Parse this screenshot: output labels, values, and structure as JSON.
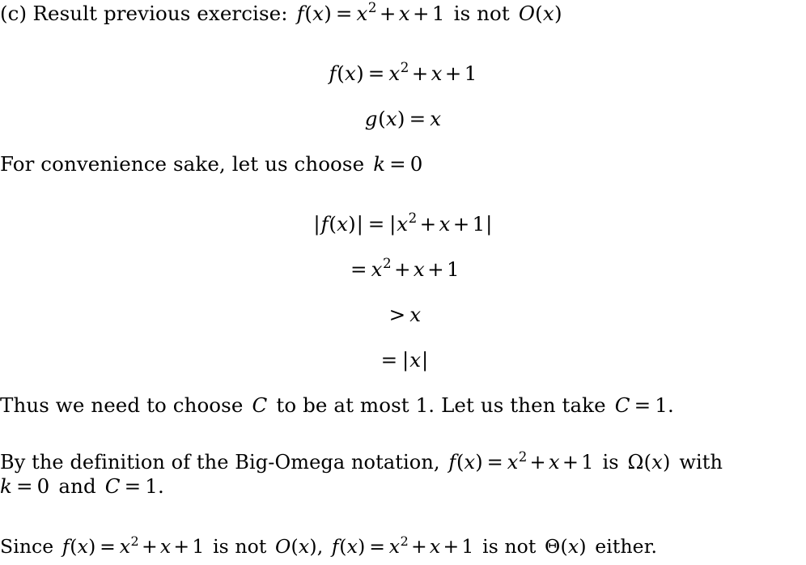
{
  "document": {
    "title": "(c) Result previous exercise",
    "background_color": "#ffffff",
    "text_color": "#000000"
  },
  "lines": {
    "heading": {
      "label": "(c)",
      "text": "Result previous exercise:",
      "math": "f(x) = x^2 + x + 1",
      "tail": "is not",
      "math2": "O(x)",
      "full": "(c) Result previous exercise: f(x) = x^2 + x + 1 is not O(x)"
    },
    "display1": {
      "full": "f(x) = x^2 + x + 1"
    },
    "display2": {
      "full": "g(x) = x"
    },
    "convenience": {
      "text": "For convenience sake, let us choose",
      "math": "k = 0",
      "full": "For convenience sake, let us choose k = 0"
    },
    "derivation1": {
      "full": "|f(x)| = |x^2 + x + 1|"
    },
    "derivation2": {
      "full": "= x^2 + x + 1"
    },
    "derivation3": {
      "full": "> x"
    },
    "derivation4": {
      "full": "= |x|"
    },
    "thus": {
      "part1": "Thus we need to choose",
      "mathC": "C",
      "part2": "to be at most 1. Let us then take",
      "mathC2": "C = 1.",
      "full": "Thus we need to choose C to be at most 1. Let us then take C = 1."
    },
    "bigomega_a": {
      "part1": "By the definition of the Big-Omega notation,",
      "math": "f(x) = x^2 + x + 1",
      "part2": "is",
      "math2": "Ω(x)",
      "part3": "with",
      "full": "By the definition of the Big-Omega notation, f(x) = x^2 + x + 1 is Ω(x) with"
    },
    "bigomega_b": {
      "full": "k = 0 and C = 1."
    },
    "since": {
      "part1": "Since",
      "math1": "f(x) = x^2 + x + 1",
      "part2": "is not",
      "math2": "O(x),",
      "math3": "f(x) = x^2 + x + 1",
      "part3": "is not",
      "math4": "Θ(x)",
      "part4": "either.",
      "full": "Since f(x) = x^2 + x + 1 is not O(x), f(x) = x^2 + x + 1 is not Θ(x) either."
    }
  },
  "symbols": {
    "fvar": "f",
    "gvar": "g",
    "xvar": "x",
    "kvar": "k",
    "cvar": "C",
    "bigo": "O",
    "omega": "Ω",
    "theta": "Θ",
    "equals": "=",
    "greater": ">",
    "plus": "+",
    "one": "1",
    "zero": "0",
    "two": "2",
    "lparen": "(",
    "rparen": ")",
    "vbar": "|",
    "comma": ",",
    "period": ".",
    "colon": ":"
  }
}
